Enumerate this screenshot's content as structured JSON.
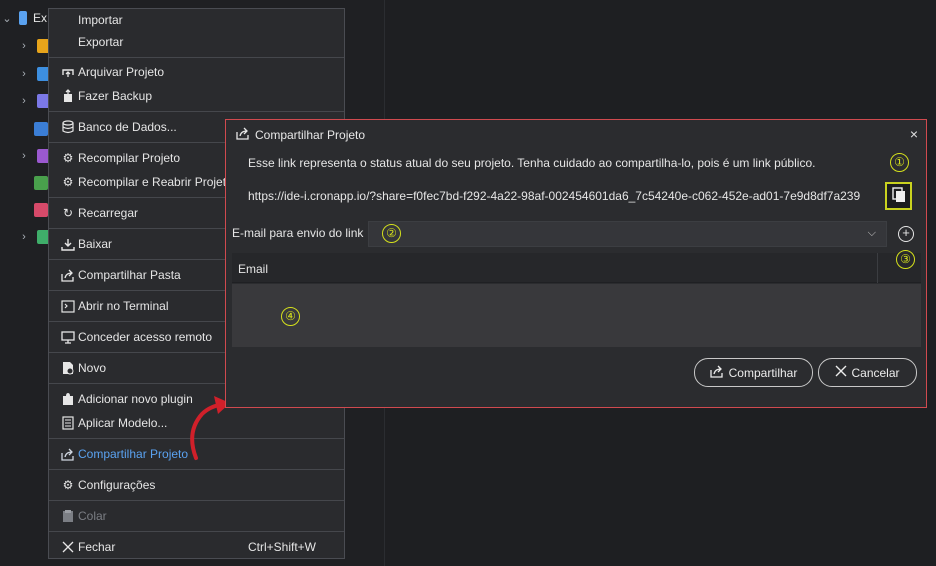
{
  "tree": {
    "root_label": "Ex"
  },
  "context_menu": {
    "items": [
      {
        "label": "Importar",
        "icon": "none"
      },
      {
        "label": "Exportar",
        "icon": "none"
      },
      {
        "label": "Arquivar Projeto",
        "icon": "archive-icon"
      },
      {
        "label": "Fazer Backup",
        "icon": "backup-icon"
      },
      {
        "label": "Banco de Dados...",
        "icon": "database-icon"
      },
      {
        "label": "Recompilar Projeto",
        "icon": "gears-icon"
      },
      {
        "label": "Recompilar e Reabrir Projeto",
        "icon": "gears-icon"
      },
      {
        "label": "Recarregar",
        "icon": "reload-icon"
      },
      {
        "label": "Baixar",
        "icon": "download-icon"
      },
      {
        "label": "Compartilhar Pasta",
        "icon": "share-icon"
      },
      {
        "label": "Abrir no Terminal",
        "icon": "terminal-icon"
      },
      {
        "label": "Conceder acesso remoto",
        "icon": "monitor-icon"
      },
      {
        "label": "Novo",
        "icon": "new-file-icon"
      },
      {
        "label": "Adicionar novo plugin",
        "icon": "puzzle-icon"
      },
      {
        "label": "Aplicar Modelo...",
        "icon": "template-icon"
      },
      {
        "label": "Compartilhar Projeto",
        "icon": "share-icon"
      },
      {
        "label": "Configurações",
        "icon": "gear-icon"
      },
      {
        "label": "Colar",
        "icon": "paste-icon"
      },
      {
        "label": "Fechar",
        "icon": "close-icon",
        "shortcut": "Ctrl+Shift+W"
      }
    ]
  },
  "dialog": {
    "title": "Compartilhar Projeto",
    "close_glyph": "×",
    "description": "Esse link representa o status atual do seu projeto. Tenha cuidado ao compartilha-lo, pois é um link público.",
    "link": "https://ide-i.cronapp.io/?share=f0fec7bd-f292-4a22-98af-002454601da6_7c54240e-c062-452e-ad01-7e9d8df7a239",
    "email_label": "E-mail para envio do link",
    "add_glyph": "+",
    "table_header": "Email",
    "share_button": "Compartilhar",
    "cancel_button": "Cancelar"
  },
  "markers": [
    "①",
    "②",
    "③",
    "④"
  ],
  "colors": {
    "accent_blue": "#5aa2f0",
    "dialog_border": "#d04a4f",
    "marker_yellow": "#d4e01c",
    "arrow_red": "#d0202a"
  }
}
